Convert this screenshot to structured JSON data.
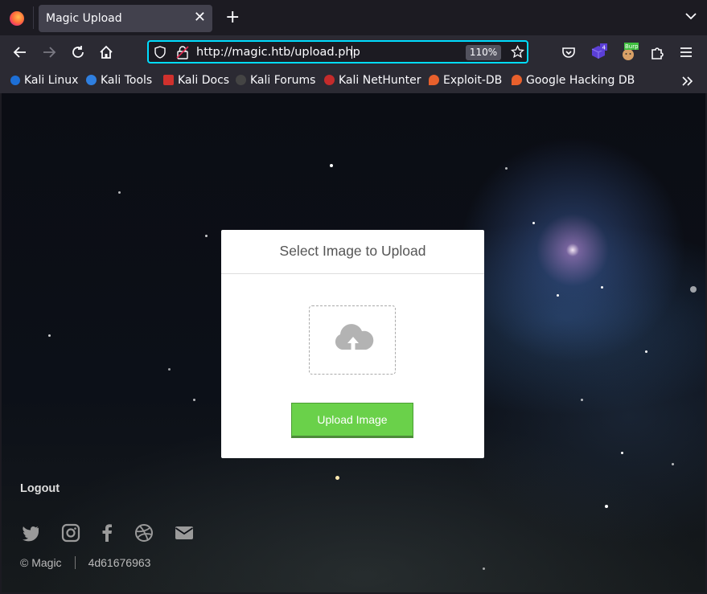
{
  "browser": {
    "tab_title": "Magic Upload",
    "url": "http://magic.htb/upload.php",
    "zoom": "110%",
    "extension_badge": "4",
    "burp_label": "Burp"
  },
  "bookmarks": [
    {
      "label": "Kali Linux",
      "icon": "kali-dragon-icon"
    },
    {
      "label": "Kali Tools",
      "icon": "kali-tools-icon"
    },
    {
      "label": "Kali Docs",
      "icon": "kali-docs-icon"
    },
    {
      "label": "Kali Forums",
      "icon": "kali-forums-icon"
    },
    {
      "label": "Kali NetHunter",
      "icon": "kali-nethunter-icon"
    },
    {
      "label": "Exploit-DB",
      "icon": "exploit-db-icon"
    },
    {
      "label": "Google Hacking DB",
      "icon": "ghdb-icon"
    }
  ],
  "upload": {
    "title": "Select Image to Upload",
    "button_label": "Upload Image"
  },
  "page": {
    "logout_label": "Logout",
    "copyright": "© Magic",
    "hash": "4d61676963",
    "social_icons": [
      "twitter-icon",
      "instagram-icon",
      "facebook-icon",
      "dribbble-icon",
      "envelope-icon"
    ]
  },
  "colors": {
    "accent_url_border": "#00ddff",
    "upload_button": "#6ad14a"
  }
}
